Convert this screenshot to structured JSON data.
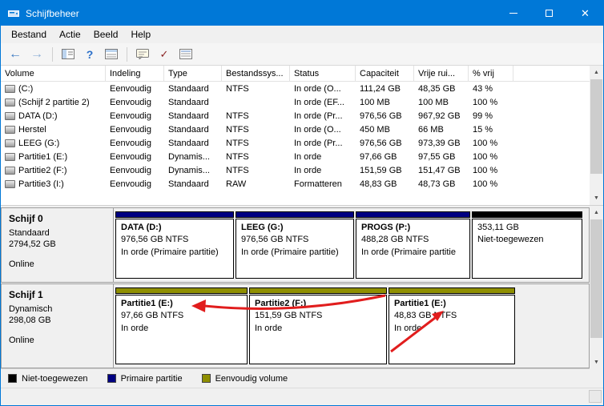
{
  "window": {
    "title": "Schijfbeheer"
  },
  "menu": {
    "items": [
      "Bestand",
      "Actie",
      "Beeld",
      "Help"
    ]
  },
  "toolbar": {
    "icons": [
      "back-icon",
      "forward-icon",
      "console-tree-icon",
      "help-icon",
      "export-list-icon",
      "dialog-icon",
      "check-icon",
      "properties-list-icon"
    ]
  },
  "table": {
    "columns": [
      "Volume",
      "Indeling",
      "Type",
      "Bestandssys...",
      "Status",
      "Capaciteit",
      "Vrije rui...",
      "% vrij"
    ],
    "rows": [
      {
        "volume": "(C:)",
        "indeling": "Eenvoudig",
        "type": "Standaard",
        "fs": "NTFS",
        "status": "In orde (O...",
        "capaciteit": "111,24 GB",
        "vrij": "48,35 GB",
        "pct": "43 %"
      },
      {
        "volume": "(Schijf 2 partitie 2)",
        "indeling": "Eenvoudig",
        "type": "Standaard",
        "fs": "",
        "status": "In orde (EF...",
        "capaciteit": "100 MB",
        "vrij": "100 MB",
        "pct": "100 %"
      },
      {
        "volume": "DATA (D:)",
        "indeling": "Eenvoudig",
        "type": "Standaard",
        "fs": "NTFS",
        "status": "In orde (Pr...",
        "capaciteit": "976,56 GB",
        "vrij": "967,92 GB",
        "pct": "99 %"
      },
      {
        "volume": "Herstel",
        "indeling": "Eenvoudig",
        "type": "Standaard",
        "fs": "NTFS",
        "status": "In orde (O...",
        "capaciteit": "450 MB",
        "vrij": "66 MB",
        "pct": "15 %"
      },
      {
        "volume": "LEEG (G:)",
        "indeling": "Eenvoudig",
        "type": "Standaard",
        "fs": "NTFS",
        "status": "In orde (Pr...",
        "capaciteit": "976,56 GB",
        "vrij": "973,39 GB",
        "pct": "100 %"
      },
      {
        "volume": "Partitie1 (E:)",
        "indeling": "Eenvoudig",
        "type": "Dynamis...",
        "fs": "NTFS",
        "status": "In orde",
        "capaciteit": "97,66 GB",
        "vrij": "97,55 GB",
        "pct": "100 %"
      },
      {
        "volume": "Partitie2 (F:)",
        "indeling": "Eenvoudig",
        "type": "Dynamis...",
        "fs": "NTFS",
        "status": "In orde",
        "capaciteit": "151,59 GB",
        "vrij": "151,47 GB",
        "pct": "100 %"
      },
      {
        "volume": "Partitie3 (I:)",
        "indeling": "Eenvoudig",
        "type": "Standaard",
        "fs": "RAW",
        "status": "Formatteren",
        "capaciteit": "48,83 GB",
        "vrij": "48,73 GB",
        "pct": "100 %"
      }
    ]
  },
  "disks": [
    {
      "name": "Schijf 0",
      "type": "Standaard",
      "size": "2794,52 GB",
      "status": "Online",
      "partitions": [
        {
          "label": "DATA  (D:)",
          "size": "976,56 GB NTFS",
          "status": "In orde (Primaire partitie)",
          "color": "#000082"
        },
        {
          "label": "LEEG  (G:)",
          "size": "976,56 GB NTFS",
          "status": "In orde (Primaire partitie)",
          "color": "#000082"
        },
        {
          "label": "PROGS  (P:)",
          "size": "488,28 GB NTFS",
          "status": "In orde (Primaire partitie",
          "color": "#000082"
        },
        {
          "label": "",
          "size": "353,11 GB",
          "status": "Niet-toegewezen",
          "color": "#000000"
        }
      ]
    },
    {
      "name": "Schijf 1",
      "type": "Dynamisch",
      "size": "298,08 GB",
      "status": "Online",
      "partitions": [
        {
          "label": "Partitie1  (E:)",
          "size": "97,66 GB NTFS",
          "status": "In orde",
          "color": "#8f8f00"
        },
        {
          "label": "Partitie2  (F:)",
          "size": "151,59 GB NTFS",
          "status": "In orde",
          "color": "#8f8f00"
        },
        {
          "label": "Partitie1  (E:)",
          "size": "48,83 GB NTFS",
          "status": "In orde",
          "color": "#8f8f00"
        }
      ]
    }
  ],
  "legend": {
    "items": [
      {
        "label": "Niet-toegewezen",
        "color": "#000000"
      },
      {
        "label": "Primaire partitie",
        "color": "#000082"
      },
      {
        "label": "Eenvoudig volume",
        "color": "#8f8f00"
      }
    ]
  },
  "colors": {
    "titlebar": "#0078d7",
    "annotation": "#e11d1d"
  }
}
